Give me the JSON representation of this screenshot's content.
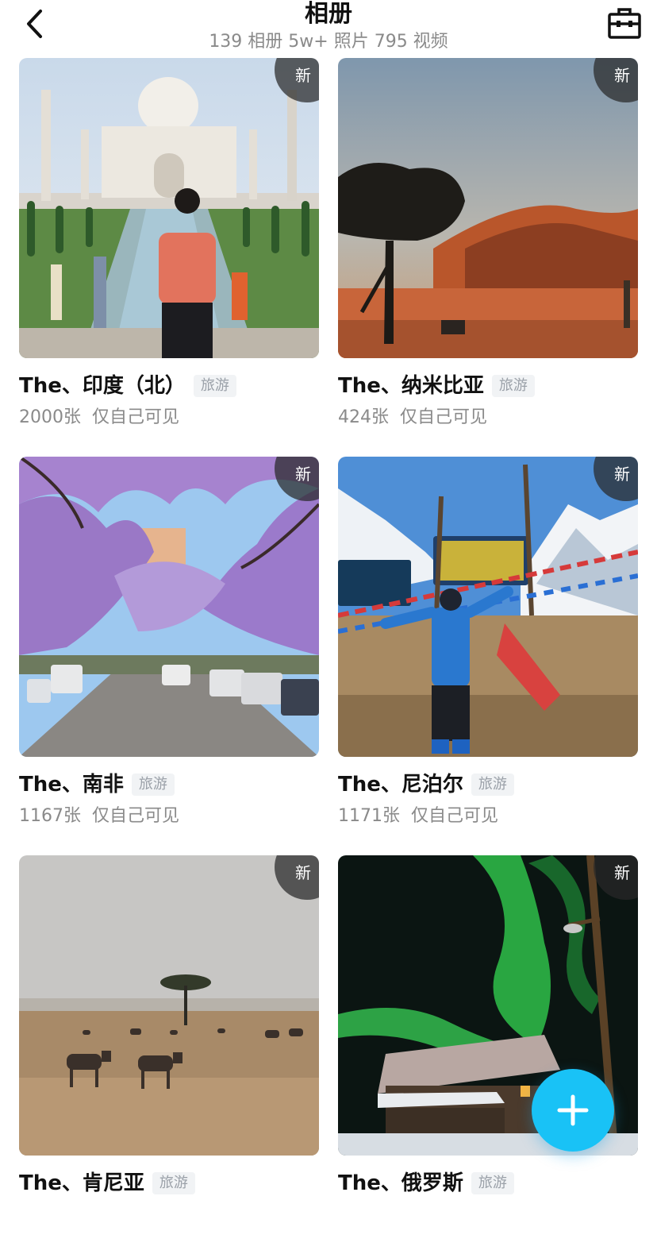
{
  "header": {
    "title": "相册",
    "subtitle": "139 相册 5w+ 照片 795 视频"
  },
  "albums": [
    {
      "name": "The、印度（北）",
      "tag": "旅游",
      "count": "2000张",
      "visibility": "仅自己可见",
      "badge": "新"
    },
    {
      "name": "The、纳米比亚",
      "tag": "旅游",
      "count": "424张",
      "visibility": "仅自己可见",
      "badge": "新"
    },
    {
      "name": "The、南非",
      "tag": "旅游",
      "count": "1167张",
      "visibility": "仅自己可见",
      "badge": "新"
    },
    {
      "name": "The、尼泊尔",
      "tag": "旅游",
      "count": "1171张",
      "visibility": "仅自己可见",
      "badge": "新"
    },
    {
      "name": "The、肯尼亚",
      "tag": "旅游",
      "badge": "新"
    },
    {
      "name": "The、俄罗斯",
      "tag": "旅游",
      "badge": "新"
    }
  ],
  "icons": {
    "back": "chevron-left-icon",
    "toolbox": "toolbox-icon",
    "add": "plus-icon"
  },
  "colors": {
    "accent": "#19c2f6",
    "badge_bg": "#2a2a2a",
    "muted_text": "#8a8a8a",
    "tag_bg": "#f1f3f5"
  }
}
